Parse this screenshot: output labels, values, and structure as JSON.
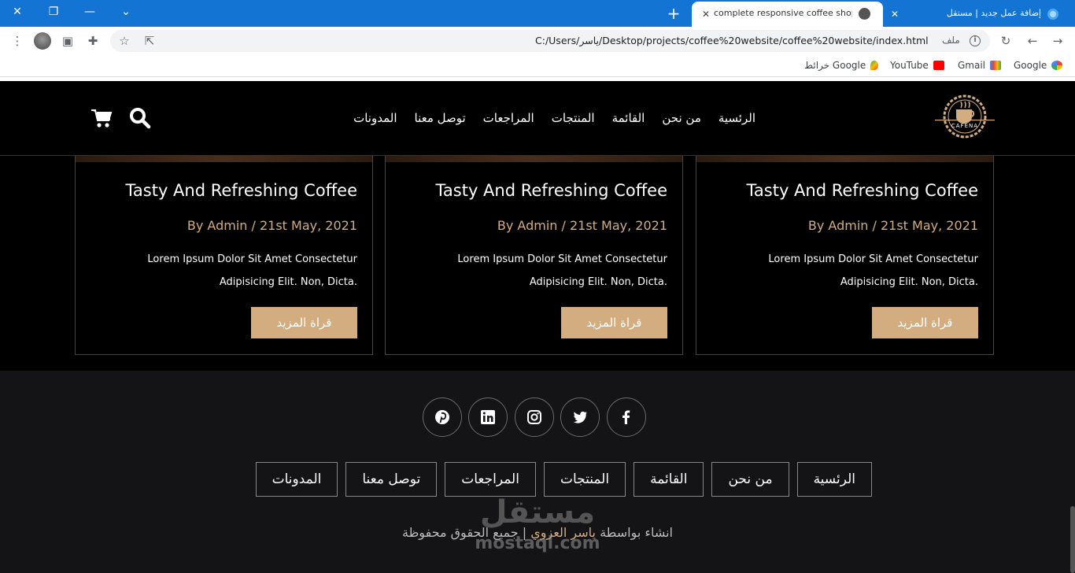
{
  "browser": {
    "active_tab_title": "complete responsive coffee shop",
    "inactive_tab_title": "إضافة عمل جديد | مستقل",
    "url": "C:/Users/ياسر/Desktop/projects/coffee%20website/coffee%20website/index.html",
    "file_label": "ملف",
    "bookmarks": [
      {
        "label": "Google",
        "icon": "google-icon"
      },
      {
        "label": "Gmail",
        "icon": "gmail-icon"
      },
      {
        "label": "YouTube",
        "icon": "youtube-icon"
      },
      {
        "label": "خرائط Google",
        "icon": "maps-icon"
      }
    ]
  },
  "header": {
    "logo_text": "CAFENA",
    "nav": [
      "الرئسية",
      "من نحن",
      "القائمة",
      "المنتجات",
      "المراجعات",
      "توصل معنا",
      "المدونات"
    ]
  },
  "blog": {
    "cards": [
      {
        "title": "Tasty And Refreshing Coffee",
        "meta": "By Admin / 21st May, 2021",
        "line1": "Lorem Ipsum Dolor Sit Amet Consectetur",
        "line2": "Adipisicing Elit. Non, Dicta.",
        "button": "قراة المزيد"
      },
      {
        "title": "Tasty And Refreshing Coffee",
        "meta": "By Admin / 21st May, 2021",
        "line1": "Lorem Ipsum Dolor Sit Amet Consectetur",
        "line2": "Adipisicing Elit. Non, Dicta.",
        "button": "قراة المزيد"
      },
      {
        "title": "Tasty And Refreshing Coffee",
        "meta": "By Admin / 21st May, 2021",
        "line1": "Lorem Ipsum Dolor Sit Amet Consectetur",
        "line2": "Adipisicing Elit. Non, Dicta.",
        "button": "قراة المزيد"
      }
    ]
  },
  "footer": {
    "social": [
      "facebook-icon",
      "twitter-icon",
      "instagram-icon",
      "linkedin-icon",
      "pinterest-icon"
    ],
    "links": [
      "الرئسية",
      "من نحن",
      "القائمة",
      "المنتجات",
      "المراجعات",
      "توصل معنا",
      "المدونات"
    ],
    "credit_prefix": "انشاء بواسطة",
    "credit_name": "ياسر العزوي",
    "credit_suffix": "| جميع الحقوق محفوظة"
  },
  "watermark": {
    "arabic": "مستقل",
    "latin": "mostaql.com"
  },
  "colors": {
    "accent": "#d3ad7f",
    "chrome": "#1474d4",
    "footer_bg": "#141416"
  }
}
